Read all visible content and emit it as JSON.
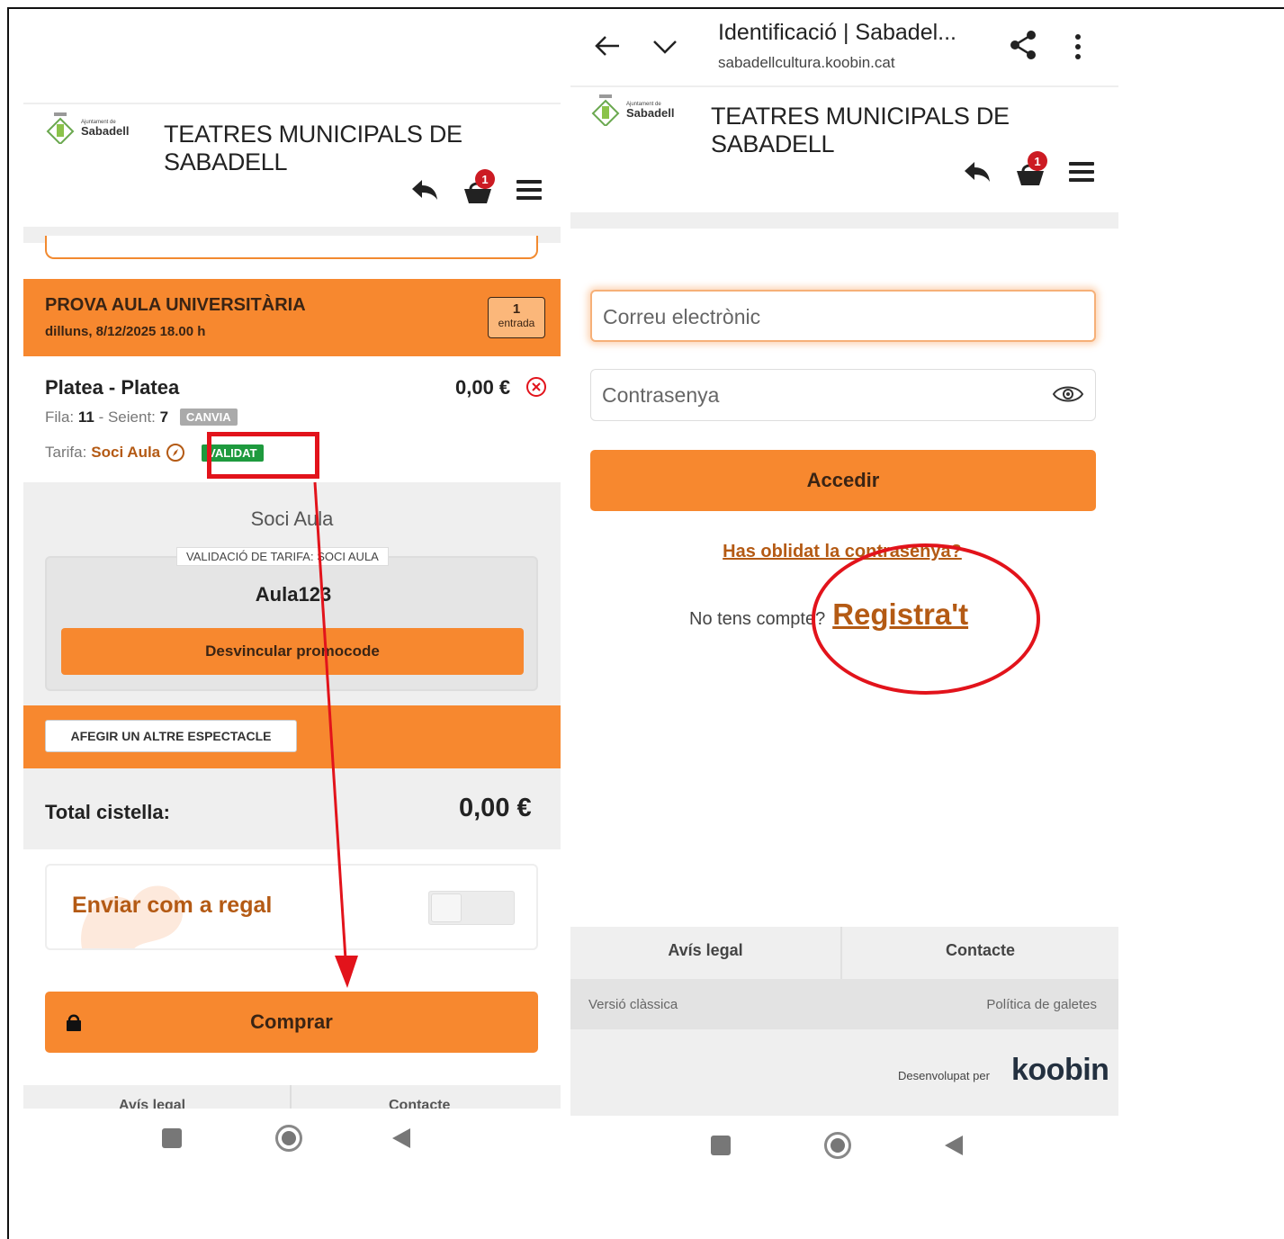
{
  "left_screen": {
    "header": {
      "logo_small": "Ajuntament de",
      "logo_big": "Sabadell",
      "title": "TEATRES MUNICIPALS DE SABADELL",
      "cart_badge": "1"
    },
    "event": {
      "title": "PROVA AULA UNIVERSITÀRIA",
      "date": "dilluns, 8/12/2025 18.00 h",
      "qty": "1",
      "qty_unit": "entrada"
    },
    "seat": {
      "title": "Platea - Platea",
      "price": "0,00 €",
      "row_label": "Fila:",
      "row_value": "11",
      "seat_label": "- Seient:",
      "seat_value": "7",
      "change_tag": "CANVIA",
      "tarifa_label": "Tarifa:",
      "tarifa_value": "Soci Aula",
      "validated_tag": "VALIDAT"
    },
    "promo": {
      "name": "Soci Aula",
      "legend": "VALIDACIÓ DE TARIFA: SOCI AULA",
      "code": "Aula123",
      "unlink_button": "Desvincular promocode"
    },
    "add_button": "AFEGIR UN ALTRE ESPECTACLE",
    "total_label": "Total cistella:",
    "total_value": "0,00 €",
    "gift_label": "Enviar com a regal",
    "gift_toggle_on": false,
    "buy_button": "Comprar",
    "footer_left": "Avís legal",
    "footer_right": "Contacte"
  },
  "right_screen": {
    "browser": {
      "tab_title": "Identificació | Sabadel...",
      "url": "sabadellcultura.koobin.cat"
    },
    "header": {
      "logo_small": "Ajuntament de",
      "logo_big": "Sabadell",
      "title": "TEATRES MUNICIPALS DE SABADELL",
      "cart_badge": "1"
    },
    "login": {
      "email_placeholder": "Correu electrònic",
      "password_placeholder": "Contrasenya",
      "submit": "Accedir",
      "forgot": "Has oblidat la contrasenya?",
      "no_account": "No tens compte?",
      "register": "Registra't"
    },
    "footer": {
      "legal": "Avís legal",
      "contact": "Contacte",
      "classic": "Versió clàssica",
      "cookies": "Política de galetes",
      "developed_by": "Desenvolupat per",
      "brand": "koobin"
    }
  },
  "colors": {
    "accent_orange": "#f7882f",
    "link_brown": "#b45a14",
    "annotation_red": "#e2131b",
    "validated_green": "#1e9a3e",
    "badge_red": "#cc1b23"
  }
}
